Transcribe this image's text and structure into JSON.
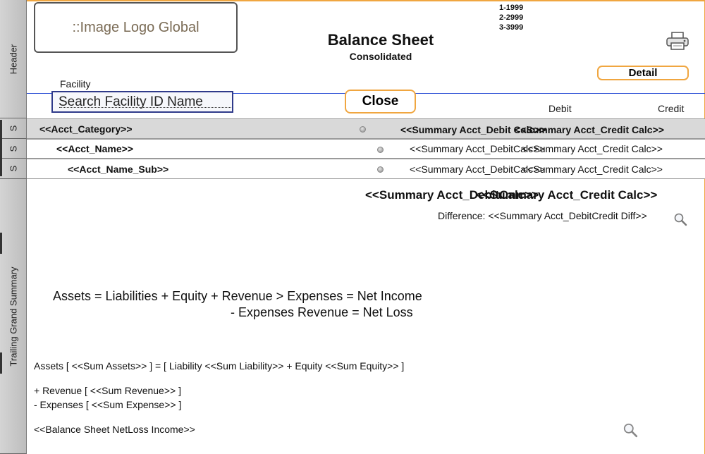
{
  "header": {
    "logo_text": "::Image Logo Global",
    "title": "Balance Sheet",
    "subtitle": "Consolidated",
    "ranges": [
      "1-1999",
      "2-2999",
      "3-3999"
    ],
    "detail_button": "Detail",
    "facility_label": "Facility",
    "search_placeholder": "Search Facility ID Name",
    "close_button": "Close",
    "debit_label": "Debit",
    "credit_label": "Credit"
  },
  "parts": {
    "header": "Header",
    "subsummary": "S",
    "trailing": "Trailing Grand Summary"
  },
  "rows": [
    {
      "label": "<<Acct_Category>>",
      "debit": "<<Summary Acct_Debit Calc>>",
      "credit": "<<Summary Acct_Credit Calc>>"
    },
    {
      "label": "<<Acct_Name>>",
      "debit": "<<Summary Acct_DebitCalc>>",
      "credit": "<<Summary Acct_Credit Calc>>"
    },
    {
      "label": "<<Acct_Name_Sub>>",
      "debit": "<<Summary Acct_DebitCalc>>",
      "credit": "<<Summary Acct_Credit Calc>>"
    }
  ],
  "grand_summary": {
    "debit": "<<Summary Acct_DebitCalc>>",
    "credit": "<<Summary Acct_Credit Calc>>",
    "difference": "Difference: <<Summary Acct_DebitCredit Diff>>",
    "equation1": "Assets = Liabilities + Equity + Revenue > Expenses = Net Income",
    "equation2": "- Expenses  Revenue = Net Loss",
    "assets_line": "Assets [ <<Sum Assets>> ] =  [ Liability <<Sum Liability>> + Equity <<Sum Equity>> ]",
    "revenue_line": "+ Revenue [ <<Sum Revenue>> ]",
    "expenses_line": "- Expenses [ <<Sum Expense>> ]",
    "netloss_line": "<<Balance Sheet NetLoss Income>>"
  },
  "colors": {
    "accent_orange": "#f0a640",
    "divider_blue": "#2c4fd6",
    "row_gray": "#d9d9d9"
  },
  "icons": [
    "printer-icon",
    "magnifier-icon",
    "radio-dot-icon"
  ]
}
